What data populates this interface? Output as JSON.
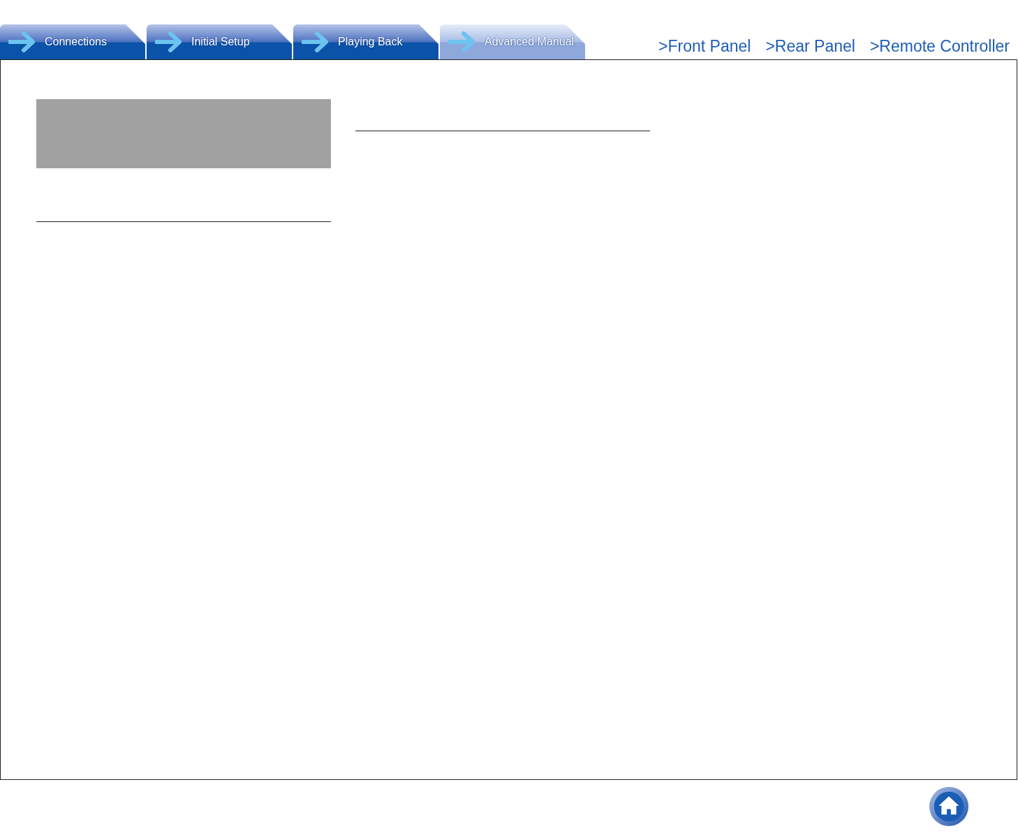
{
  "tabs": [
    {
      "label": "Connections",
      "selected": false
    },
    {
      "label": "Initial Setup",
      "selected": false
    },
    {
      "label": "Playing Back",
      "selected": false
    },
    {
      "label": "Advanced Manual",
      "selected": true
    }
  ],
  "links": [
    ">Front Panel",
    ">Rear Panel",
    ">Remote Controller"
  ]
}
